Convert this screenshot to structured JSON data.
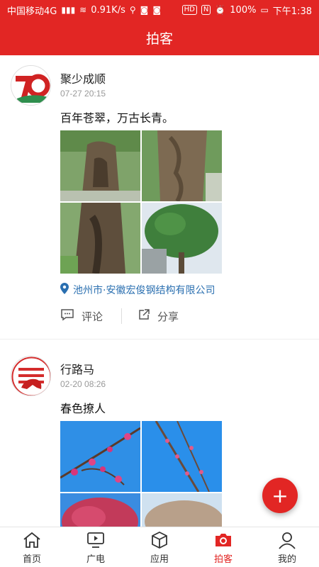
{
  "status_bar": {
    "carrier": "中国移动4G",
    "speed": "0.91K/s",
    "battery": "100%",
    "time": "下午1:38",
    "hd_badge": "HD",
    "nfc_badge": "N"
  },
  "header": {
    "title": "拍客"
  },
  "posts": [
    {
      "name": "聚少成顺",
      "time": "07-27 20:15",
      "text": "百年苍翠，万古长青。",
      "location": "池州市·安徽宏俊钢结构有限公司",
      "images": [
        "tree-trunk-1",
        "tree-trunk-2",
        "tree-trunk-3",
        "tree-canopy"
      ]
    },
    {
      "name": "行路马",
      "time": "02-20 08:26",
      "text": "春色撩人",
      "images": [
        "plum-blossom-1",
        "plum-blossom-2",
        "plum-tree",
        "park-trees"
      ]
    }
  ],
  "actions": {
    "comment": "评论",
    "share": "分享"
  },
  "fab": {
    "label": "+"
  },
  "bottom_nav": [
    {
      "label": "首页",
      "icon": "home-icon"
    },
    {
      "label": "广电",
      "icon": "tv-icon"
    },
    {
      "label": "应用",
      "icon": "cube-icon"
    },
    {
      "label": "拍客",
      "icon": "camera-icon",
      "active": true
    },
    {
      "label": "我的",
      "icon": "user-icon"
    }
  ],
  "colors": {
    "brand_red": "#e22624",
    "link_blue": "#2a6fb0"
  }
}
